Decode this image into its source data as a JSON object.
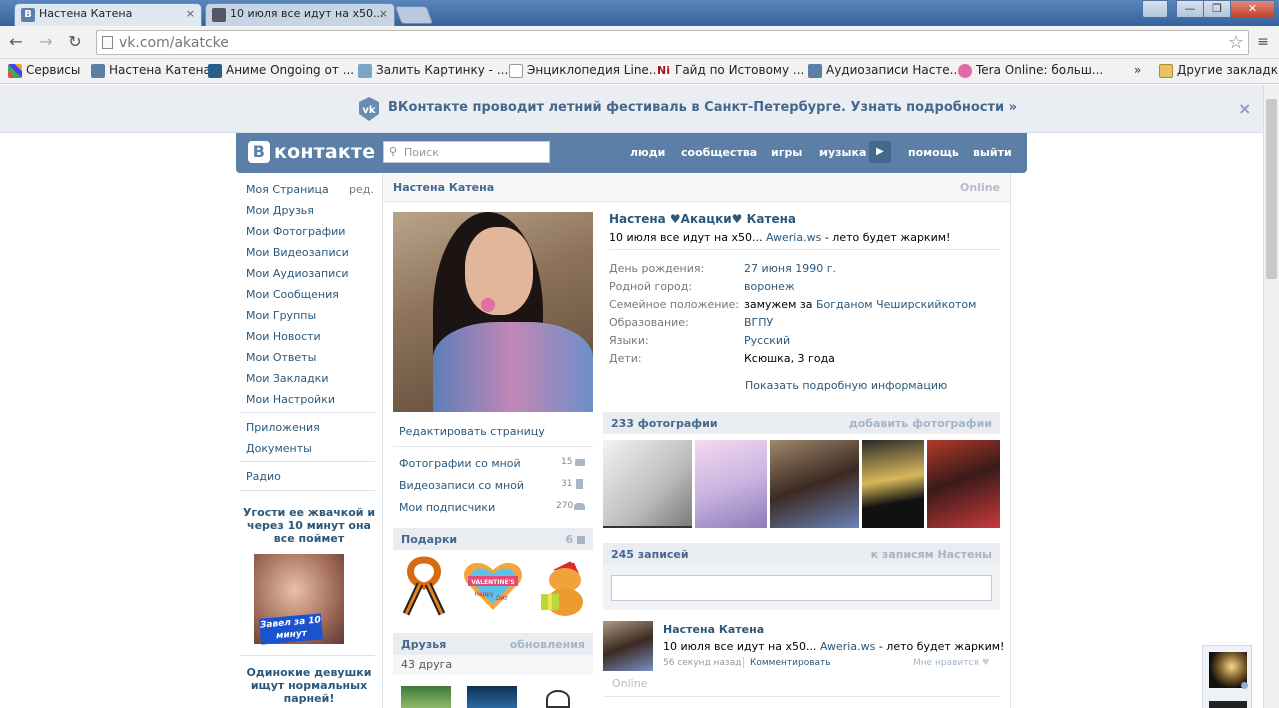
{
  "browser": {
    "tabs": [
      {
        "title": "Настена Катена",
        "close": "×"
      },
      {
        "title": "10 июля все идут на x50...",
        "close": "×"
      }
    ],
    "window_controls": [
      "—",
      "❐",
      "✕"
    ],
    "url_host": "vk.com/",
    "url_path": "akatcke",
    "bookmarks": [
      "Сервисы",
      "Настена Катена",
      "Аниме Ongoing от ...",
      "Залить Картинку - ...",
      "Энциклопедия Line...",
      "Гайд по Истовому ...",
      "Аудиозаписи Насте...",
      "Tera Online: больш...",
      "»",
      "Другие закладки"
    ]
  },
  "banner": {
    "text": "ВКонтакте проводит летний фестиваль в Санкт-Петербурге. Узнать подробности »",
    "close": "×"
  },
  "header": {
    "logo_letter": "В",
    "logo_text": "контакте",
    "search_placeholder": "Поиск",
    "links": [
      "люди",
      "сообщества",
      "игры",
      "музыка",
      "помощь",
      "выйти"
    ],
    "play_icon": "▶"
  },
  "left_nav": {
    "items": [
      "Моя Страница",
      "Мои Друзья",
      "Мои Фотографии",
      "Мои Видеозаписи",
      "Мои Аудиозаписи",
      "Мои Сообщения",
      "Мои Группы",
      "Мои Новости",
      "Мои Ответы",
      "Мои Закладки",
      "Мои Настройки"
    ],
    "edit": "ред.",
    "extra": [
      "Приложения",
      "Документы"
    ],
    "radio": "Радио",
    "ads": [
      {
        "title": "Угости ее жвачкой и через 10 минут она все поймет",
        "badge": "Завел за 10 минут"
      },
      {
        "title": "Одинокие девушки ищут нормальных парней!"
      }
    ]
  },
  "profile": {
    "page_name": "Настена Катена",
    "online": "Online",
    "full_name": "Настена ♥Акацки♥ Катена",
    "status_prefix": "10 июля все идут на x50...",
    "status_link": "Aweria.ws",
    "status_suffix": " - лето будет жарким!",
    "info": [
      {
        "label": "День рождения:",
        "value": "27 июня 1990 г."
      },
      {
        "label": "Родной город:",
        "value": "воронеж"
      },
      {
        "label": "Семейное положение:",
        "value": "замужем за ",
        "link": "Богданом Чеширскийкотом"
      },
      {
        "label": "Образование:",
        "value": "ВГПУ"
      },
      {
        "label": "Языки:",
        "value": "Русский"
      },
      {
        "label": "Дети:",
        "value": "Ксюшка, 3 года"
      }
    ],
    "show_more": "Показать подробную информацию",
    "edit_page": "Редактировать страницу",
    "counters": [
      {
        "label": "Фотографии со мной",
        "count": "15"
      },
      {
        "label": "Видеозаписи со мной",
        "count": "31"
      },
      {
        "label": "Мои подписчики",
        "count": "270"
      }
    ],
    "gifts_title": "Подарки",
    "gifts_count": "6",
    "gift_valentine": "VALENTINE'S",
    "gift_happy": "Happy",
    "gift_day": "DAY",
    "friends_title": "Друзья",
    "friends_updates": "обновления",
    "friends_count": "43 друга"
  },
  "photos": {
    "title": "233 фотографии",
    "add": "добавить фотографии"
  },
  "wall": {
    "title": "245 записей",
    "link": "к записям Настены",
    "post": {
      "author": "Настена Катена",
      "text_prefix": "10 июля все идут на x50...",
      "text_link": "Aweria.ws",
      "text_suffix": " - лето будет жарким!",
      "time": "56 секунд назад",
      "comment": "Комментировать",
      "like": "Мне нравится",
      "online": "Online"
    }
  },
  "colors": {
    "vk_blue": "#5b7fa6",
    "link": "#2b587a",
    "head_text": "#45688e"
  }
}
